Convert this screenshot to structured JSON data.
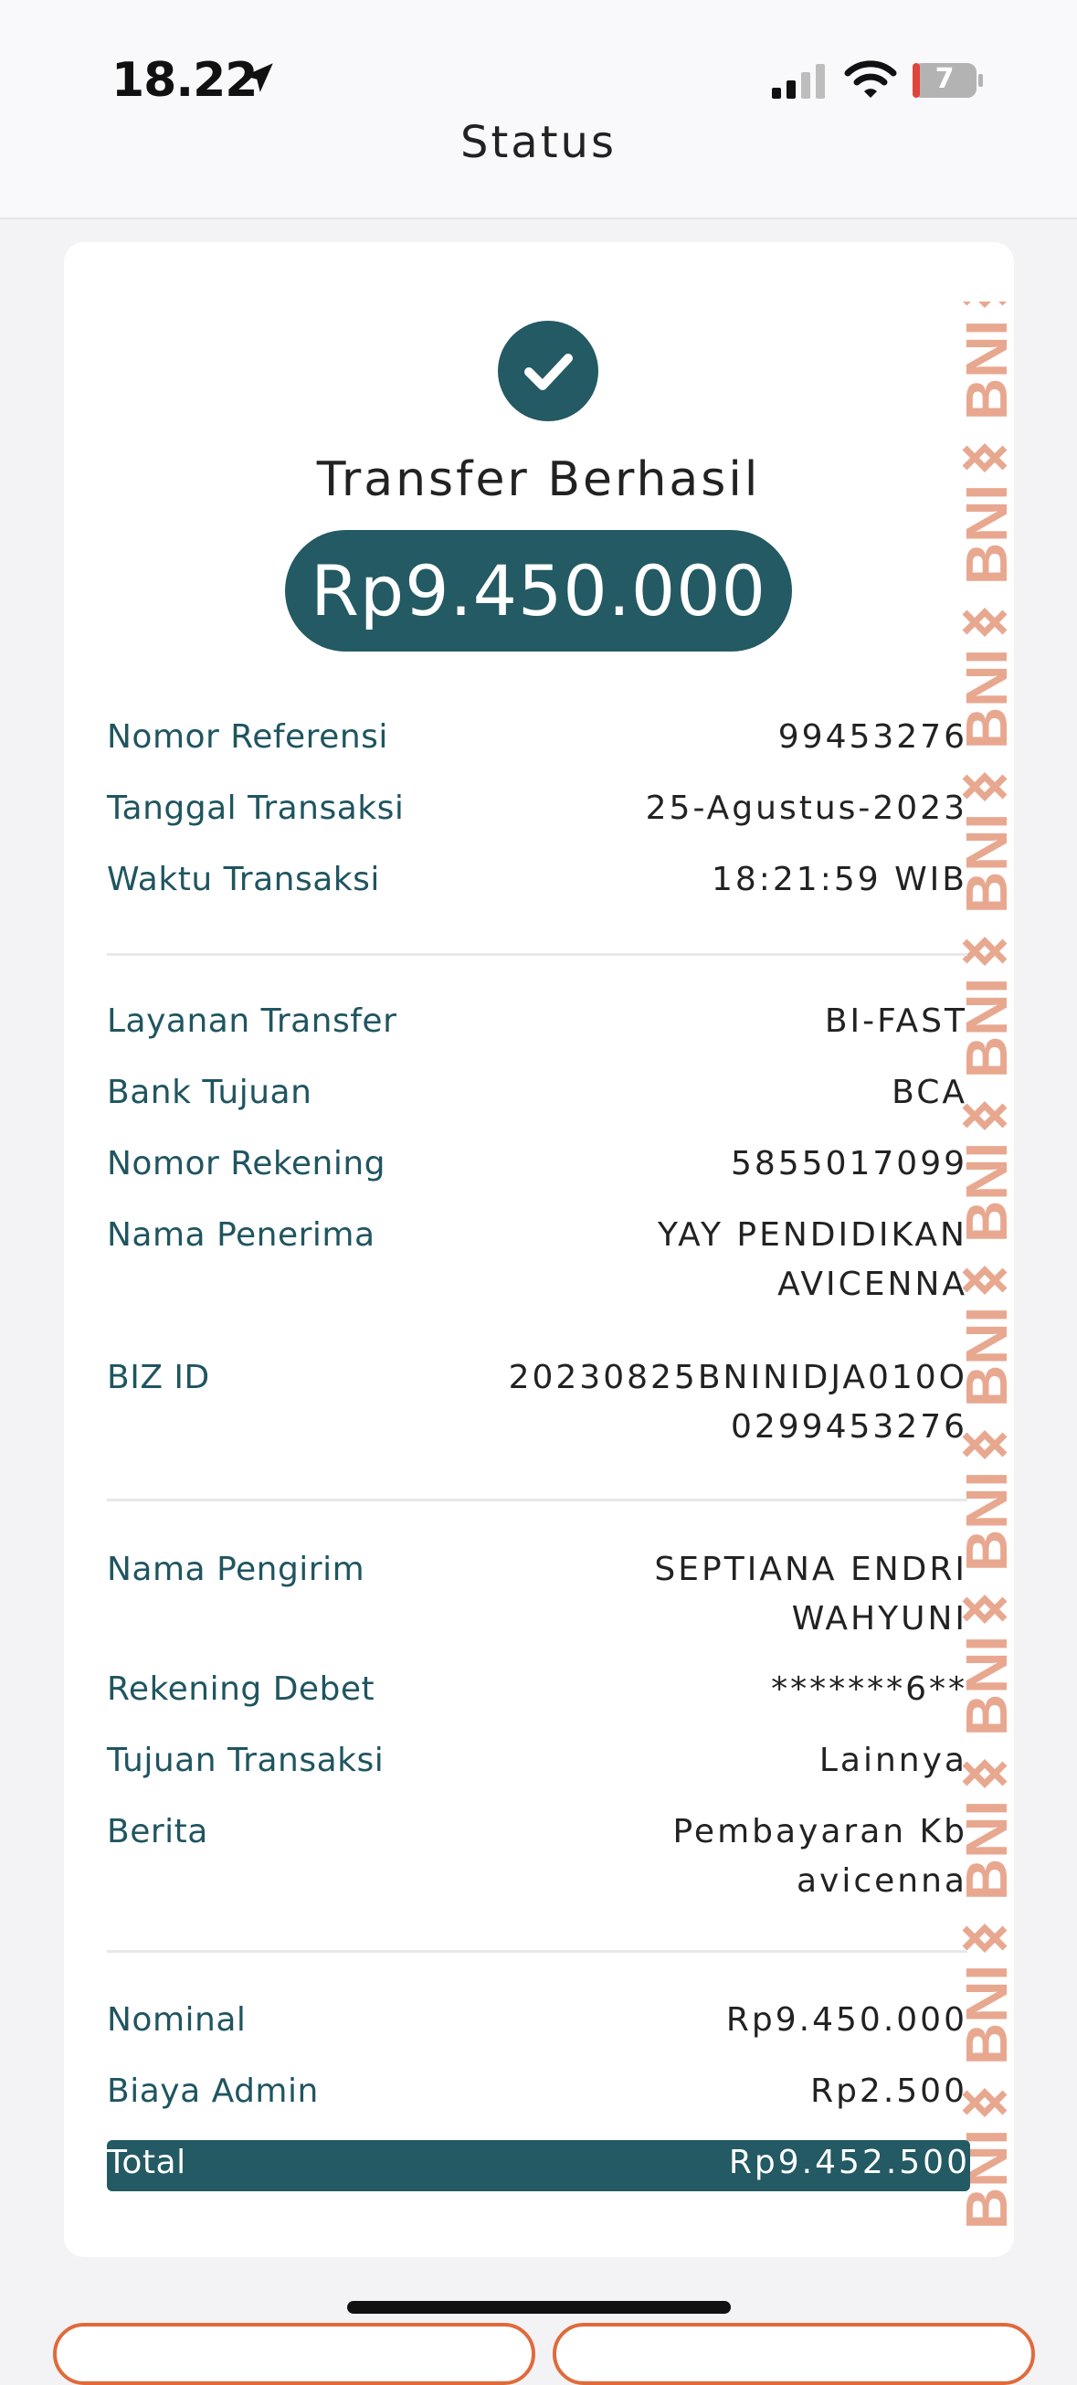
{
  "status_bar": {
    "time": "18.22",
    "battery_level": "7",
    "icons": [
      "location-arrow-icon",
      "cellular-signal-icon",
      "wifi-icon",
      "battery-icon"
    ]
  },
  "header": {
    "title": "Status"
  },
  "receipt": {
    "success_title": "Transfer Berhasil",
    "amount": "Rp9.450.000",
    "watermark_text": "BNI",
    "section1": [
      {
        "label": "Nomor Referensi",
        "value": "99453276"
      },
      {
        "label": "Tanggal Transaksi",
        "value": "25-Agustus-2023"
      },
      {
        "label": "Waktu Transaksi",
        "value": "18:21:59 WIB"
      }
    ],
    "section2": [
      {
        "label": "Layanan Transfer",
        "value": "BI-FAST"
      },
      {
        "label": "Bank Tujuan",
        "value": "BCA"
      },
      {
        "label": "Nomor Rekening",
        "value": "5855017099"
      },
      {
        "label": "Nama Penerima",
        "value_line1": "YAY PENDIDIKAN",
        "value_line2": "AVICENNA"
      },
      {
        "label": "BIZ ID",
        "value_line1": "20230825BNINIDJA010O",
        "value_line2": "0299453276"
      }
    ],
    "section3": [
      {
        "label": "Nama Pengirim",
        "value_line1": "SEPTIANA ENDRI",
        "value_line2": "WAHYUNI"
      },
      {
        "label": "Rekening Debet",
        "value": "*******6**"
      },
      {
        "label": "Tujuan Transaksi",
        "value": "Lainnya"
      },
      {
        "label": "Berita",
        "value_line1": "Pembayaran Kb",
        "value_line2": "avicenna"
      }
    ],
    "section4": [
      {
        "label": "Nominal",
        "value": "Rp9.450.000"
      },
      {
        "label": "Biaya Admin",
        "value": "Rp2.500"
      }
    ],
    "total": {
      "label": "Total",
      "value": "Rp9.452.500"
    }
  },
  "colors": {
    "primary": "#235a63",
    "label_text": "#1f5560",
    "accent_orange": "#e06a3c",
    "watermark": "#e8a890"
  }
}
